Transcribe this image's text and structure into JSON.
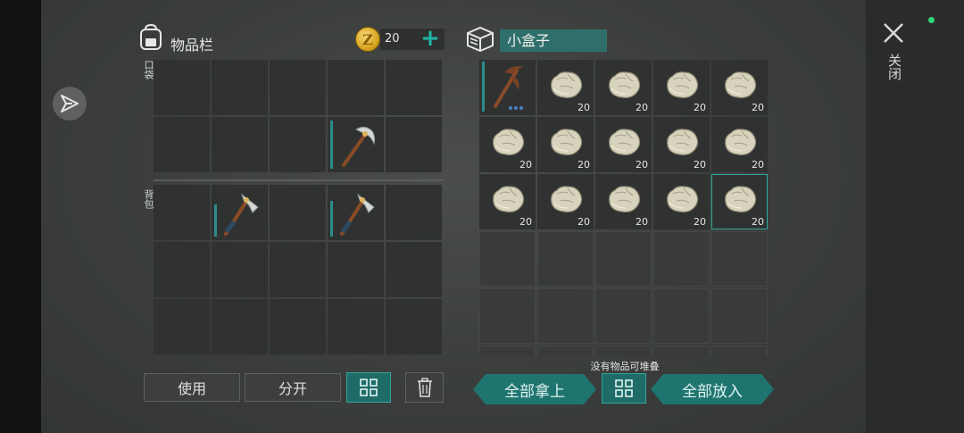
{
  "inventory": {
    "title": "物品栏",
    "coins": "20",
    "pocket_label": "口袋",
    "backpack_label": "背包",
    "pocket_rows": [
      [
        {
          "item": ""
        },
        {
          "item": ""
        },
        {
          "item": ""
        },
        {
          "item": ""
        },
        {
          "item": ""
        }
      ],
      [
        {
          "item": ""
        },
        {
          "item": ""
        },
        {
          "item": ""
        },
        {
          "item": "stone-pickaxe"
        },
        {
          "item": ""
        }
      ]
    ],
    "backpack_rows": [
      [
        {
          "item": ""
        },
        {
          "item": "stone-axe"
        },
        {
          "item": ""
        },
        {
          "item": "stone-axe"
        },
        {
          "item": ""
        }
      ],
      [
        {
          "item": ""
        },
        {
          "item": ""
        },
        {
          "item": ""
        },
        {
          "item": ""
        },
        {
          "item": ""
        }
      ],
      [
        {
          "item": ""
        },
        {
          "item": ""
        },
        {
          "item": ""
        },
        {
          "item": ""
        },
        {
          "item": ""
        }
      ]
    ]
  },
  "box": {
    "title": "小盒子",
    "stone_count": "20",
    "no_stack_hint": "没有物品可堆叠"
  },
  "buttons": {
    "use": "使用",
    "split": "分开",
    "take_all": "全部拿上",
    "put_all": "全部放入"
  },
  "close_label": "关闭",
  "colors": {
    "accent_teal": "#1f7470",
    "coin_gold": "#d9a521",
    "status_green": "#2fd67a"
  }
}
